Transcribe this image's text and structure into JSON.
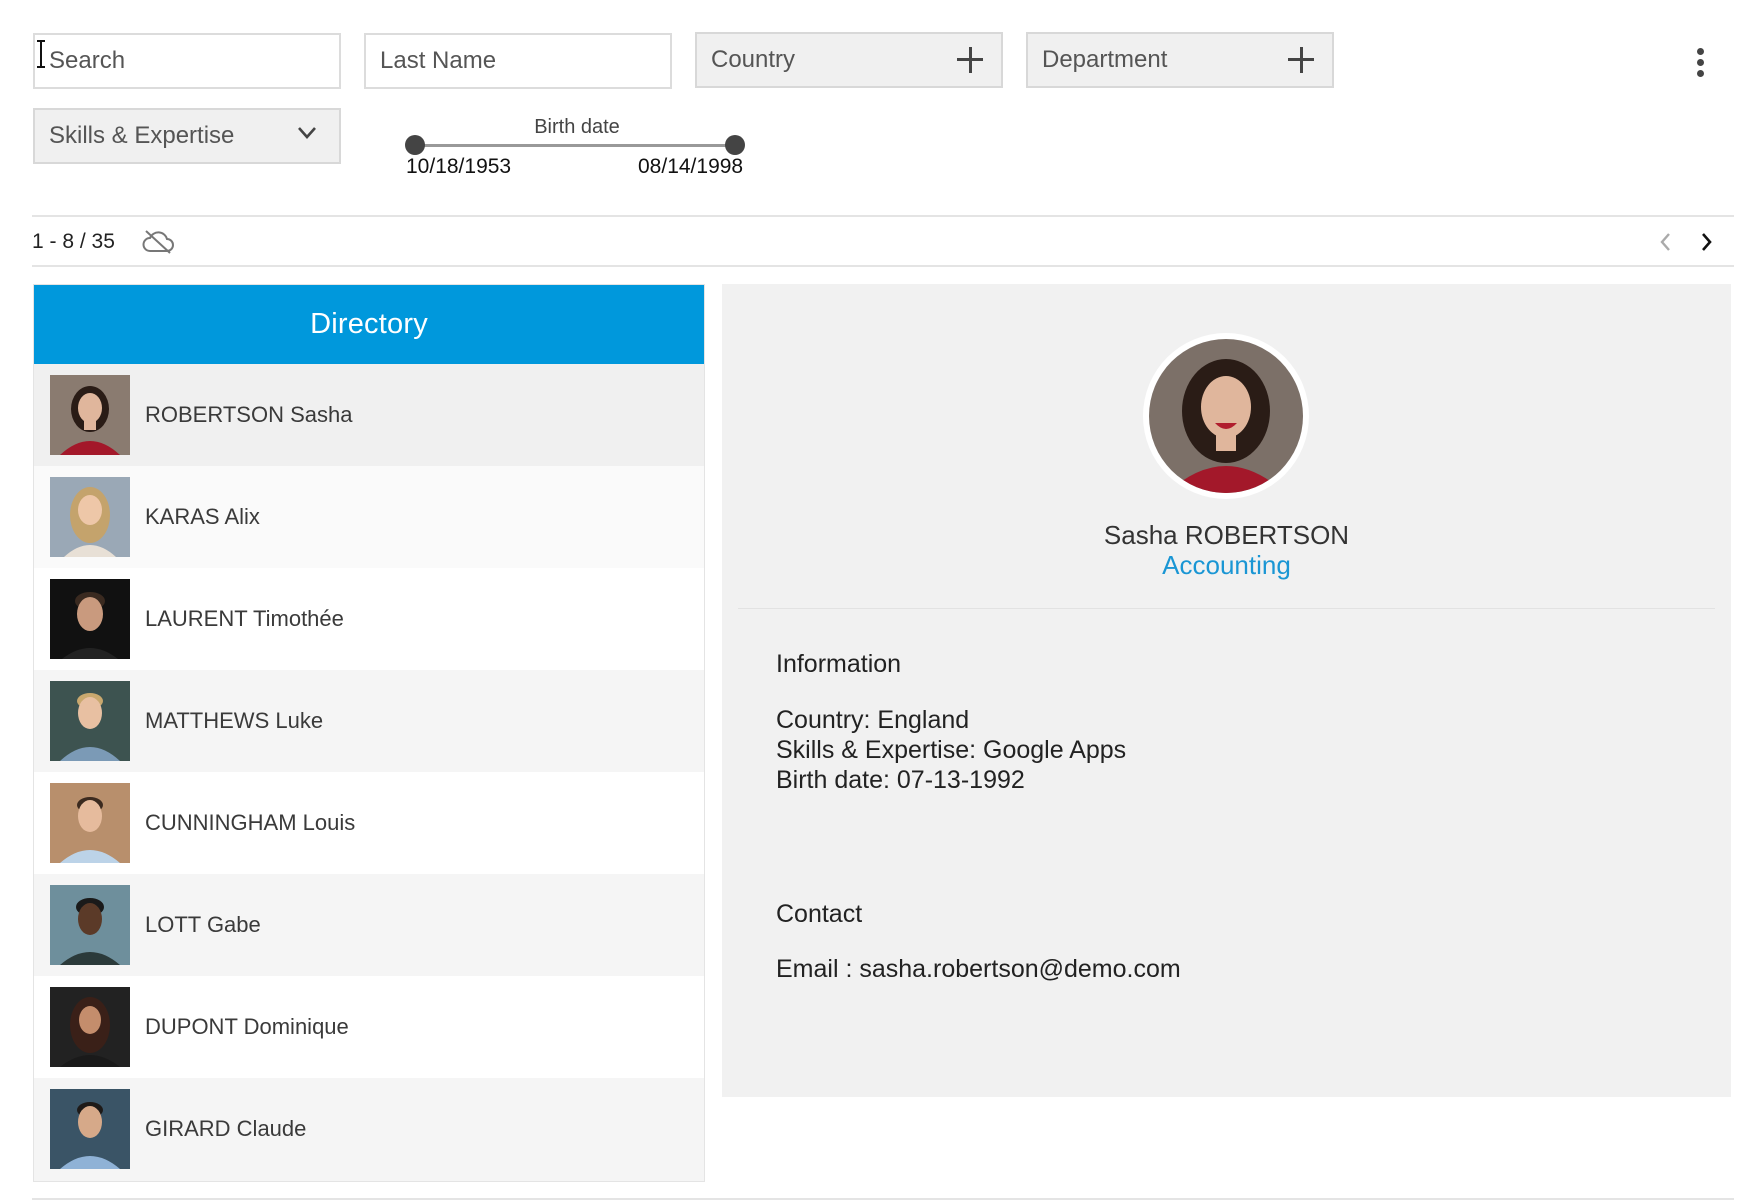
{
  "filters": {
    "search_placeholder": "Search",
    "lastname_placeholder": "Last Name",
    "country_label": "Country",
    "department_label": "Department",
    "skills_label": "Skills & Expertise"
  },
  "birth_slider": {
    "label": "Birth date",
    "min_value": "10/18/1953",
    "max_value": "08/14/1998"
  },
  "pagination": {
    "count_text": "1 - 8 / 35"
  },
  "directory": {
    "title": "Directory",
    "selected_index": 0,
    "items": [
      {
        "name": "ROBERTSON Sasha"
      },
      {
        "name": "KARAS Alix"
      },
      {
        "name": "LAURENT Timothée"
      },
      {
        "name": "MATTHEWS Luke"
      },
      {
        "name": "CUNNINGHAM Louis"
      },
      {
        "name": "LOTT Gabe"
      },
      {
        "name": "DUPONT Dominique"
      },
      {
        "name": "GIRARD Claude"
      }
    ]
  },
  "detail": {
    "full_name": "Sasha ROBERTSON",
    "department": "Accounting",
    "information_title": "Information",
    "country_line": "Country: England",
    "skills_line": "Skills & Expertise: Google Apps",
    "birth_line": "Birth date: 07-13-1992",
    "contact_title": "Contact",
    "email_line": "Email : sasha.robertson@demo.com"
  },
  "colors": {
    "accent": "#0098dc",
    "link": "#1a96d4"
  },
  "icons": [
    "plus-icon",
    "kebab-menu-icon",
    "chevron-down-icon",
    "cloud-offline-icon",
    "chevron-left-icon",
    "chevron-right-icon",
    "text-cursor-icon"
  ]
}
